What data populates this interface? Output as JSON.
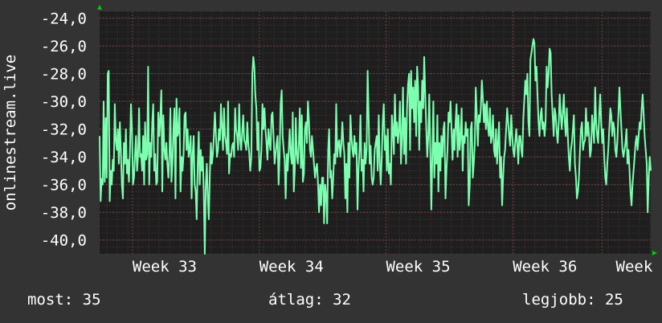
{
  "chart_data": {
    "type": "line",
    "ylabel": "onlinestream.live",
    "ylim": [
      -41,
      -23.5
    ],
    "yticks": [
      "-24,0",
      "-26,0",
      "-28,0",
      "-30,0",
      "-32,0",
      "-34,0",
      "-36,0",
      "-38,0",
      "-40,0"
    ],
    "ytick_values": [
      -24,
      -26,
      -28,
      -30,
      -32,
      -34,
      -36,
      -38,
      -40
    ],
    "xlim": [
      0,
      100
    ],
    "xticks": [
      "Week 33",
      "Week 34",
      "Week 35",
      "Week 36",
      "Week"
    ],
    "xtick_values": [
      11.8,
      34.8,
      57.8,
      80.8,
      97
    ],
    "grid": true,
    "line_color": "#7dffb0",
    "series": [
      {
        "values": [
          -32.5,
          -37.2,
          -35.6,
          -36.0,
          -30.0,
          -35.8,
          -31.2,
          -35.5,
          -28.0,
          -27.8,
          -37.2,
          -35.0,
          -36.0,
          -34.2,
          -35.0,
          -30.2,
          -32.8,
          -33.5,
          -32.0,
          -34.5,
          -31.5,
          -33.5,
          -36.0,
          -37.0,
          -33.0,
          -34.5,
          -32.0,
          -35.2,
          -34.2,
          -35.8,
          -33.5,
          -30.2,
          -32.0,
          -36.0,
          -35.5,
          -33.8,
          -32.5,
          -35.0,
          -34.0,
          -30.5,
          -34.0,
          -33.8,
          -35.0,
          -32.5,
          -36.0,
          -31.5,
          -34.2,
          -33.8,
          -27.5,
          -36.0,
          -33.0,
          -34.0,
          -31.5,
          -30.2,
          -35.0,
          -33.8,
          -36.0,
          -35.8,
          -30.8,
          -32.5,
          -31.2,
          -29.2,
          -36.5,
          -31.0,
          -33.5,
          -34.2,
          -33.0,
          -34.5,
          -35.5,
          -33.8,
          -30.5,
          -35.8,
          -34.5,
          -32.0,
          -30.5,
          -37.0,
          -29.8,
          -32.5,
          -32.2,
          -30.5,
          -36.5,
          -34.0,
          -35.0,
          -33.8,
          -31.0,
          -30.8,
          -33.5,
          -32.0,
          -34.0,
          -33.5,
          -32.5,
          -37.0,
          -33.8,
          -32.5,
          -36.0,
          -36.5,
          -38.5,
          -34.5,
          -32.2,
          -36.0,
          -33.5,
          -35.0,
          -34.0,
          -36.5,
          -41.0,
          -36.0,
          -34.5,
          -37.0,
          -38.5,
          -35.2,
          -33.0,
          -34.5,
          -33.8,
          -32.5,
          -30.8,
          -32.5,
          -34.0,
          -33.5,
          -32.0,
          -32.8,
          -30.2,
          -31.8,
          -33.5,
          -30.5,
          -32.5,
          -33.0,
          -33.8,
          -30.0,
          -35.2,
          -33.8,
          -34.0,
          -33.2,
          -33.0,
          -34.0,
          -30.5,
          -32.0,
          -32.5,
          -33.5,
          -30.2,
          -32.8,
          -33.5,
          -32.2,
          -31.0,
          -32.8,
          -33.0,
          -33.5,
          -31.5,
          -33.0,
          -33.8,
          -35.0,
          -34.0,
          -28.0,
          -26.8,
          -27.5,
          -29.5,
          -30.5,
          -33.5,
          -31.5,
          -35.0,
          -34.8,
          -33.5,
          -30.2,
          -32.0,
          -30.5,
          -32.0,
          -33.0,
          -34.2,
          -32.0,
          -33.0,
          -33.5,
          -31.0,
          -30.8,
          -32.5,
          -34.5,
          -33.8,
          -33.0,
          -32.5,
          -36.0,
          -33.8,
          -30.2,
          -29.2,
          -32.5,
          -33.5,
          -34.2,
          -37.0,
          -33.8,
          -35.0,
          -33.5,
          -32.0,
          -33.8,
          -34.5,
          -30.8,
          -36.5,
          -35.0,
          -31.2,
          -33.8,
          -34.5,
          -33.0,
          -30.5,
          -34.8,
          -31.0,
          -35.8,
          -35.2,
          -32.0,
          -31.5,
          -33.0,
          -30.0,
          -31.5,
          -33.5,
          -34.0,
          -32.5,
          -33.5,
          -34.5,
          -35.5,
          -34.8,
          -34.5,
          -36.0,
          -38.0,
          -36.0,
          -37.5,
          -35.5,
          -35.5,
          -38.8,
          -36.0,
          -36.8,
          -38.8,
          -33.5,
          -32.0,
          -35.5,
          -35.0,
          -37.0,
          -35.5,
          -33.8,
          -34.5,
          -30.2,
          -34.0,
          -33.0,
          -32.8,
          -34.0,
          -33.2,
          -31.5,
          -33.0,
          -33.8,
          -37.0,
          -34.5,
          -38.0,
          -33.0,
          -35.5,
          -31.0,
          -32.5,
          -33.5,
          -34.0,
          -32.5,
          -33.8,
          -33.0,
          -37.8,
          -35.0,
          -33.5,
          -31.0,
          -35.0,
          -34.2,
          -36.5,
          -33.0,
          -34.5,
          -33.5,
          -27.8,
          -31.0,
          -34.5,
          -33.2,
          -35.5,
          -36.0,
          -35.5,
          -33.5,
          -33.0,
          -32.5,
          -35.0,
          -31.0,
          -34.5,
          -36.0,
          -34.0,
          -31.5,
          -30.2,
          -33.5,
          -32.5,
          -35.0,
          -32.0,
          -35.2,
          -34.5,
          -36.0,
          -31.0,
          -32.0,
          -33.8,
          -29.5,
          -32.5,
          -31.5,
          -33.0,
          -32.0,
          -30.0,
          -34.5,
          -32.5,
          -29.0,
          -33.8,
          -31.2,
          -34.5,
          -30.5,
          -28.8,
          -28.0,
          -33.5,
          -27.8,
          -30.5,
          -29.0,
          -31.5,
          -28.5,
          -32.5,
          -27.5,
          -29.0,
          -33.5,
          -30.0,
          -31.5,
          -28.5,
          -30.5,
          -26.8,
          -29.5,
          -32.0,
          -34.0,
          -32.5,
          -29.5,
          -33.5,
          -37.8,
          -34.0,
          -30.0,
          -35.5,
          -33.0,
          -34.5,
          -31.0,
          -36.5,
          -33.0,
          -35.0,
          -32.5,
          -34.0,
          -32.0,
          -31.5,
          -37.0,
          -35.0,
          -33.5,
          -30.8,
          -31.5,
          -30.0,
          -32.0,
          -34.2,
          -32.0,
          -33.5,
          -31.5,
          -30.2,
          -34.0,
          -31.0,
          -33.5,
          -32.5,
          -30.5,
          -35.0,
          -32.5,
          -33.0,
          -31.5,
          -32.5,
          -32.0,
          -37.5,
          -36.0,
          -32.0,
          -31.5,
          -35.5,
          -34.5,
          -33.0,
          -29.0,
          -31.0,
          -33.2,
          -31.0,
          -31.5,
          -30.5,
          -28.5,
          -29.8,
          -31.5,
          -30.2,
          -32.0,
          -30.0,
          -31.8,
          -32.5,
          -30.5,
          -33.0,
          -32.5,
          -31.0,
          -33.5,
          -34.0,
          -32.0,
          -34.5,
          -33.0,
          -31.5,
          -35.5,
          -34.0,
          -37.5,
          -35.5,
          -34.0,
          -33.5,
          -32.0,
          -30.5,
          -31.5,
          -32.5,
          -33.2,
          -31.0,
          -32.5,
          -33.5,
          -34.0,
          -33.0,
          -32.0,
          -33.0,
          -34.5,
          -32.5,
          -32.5,
          -33.5,
          -34.0,
          -31.2,
          -29.8,
          -28.5,
          -29.5,
          -28.0,
          -31.5,
          -32.5,
          -27.0,
          -26.5,
          -26.0,
          -25.5,
          -25.8,
          -28.5,
          -27.5,
          -29.5,
          -31.5,
          -32.5,
          -31.0,
          -30.5,
          -32.0,
          -31.5,
          -32.5,
          -31.5,
          -27.5,
          -29.0,
          -28.0,
          -26.2,
          -26.5,
          -29.5,
          -31.0,
          -32.5,
          -30.5,
          -31.0,
          -32.2,
          -33.0,
          -31.5,
          -29.5,
          -31.0,
          -32.0,
          -30.8,
          -29.5,
          -31.5,
          -32.5,
          -30.5,
          -32.5,
          -34.0,
          -35.0,
          -33.5,
          -33.0,
          -32.0,
          -31.0,
          -34.5,
          -35.5,
          -37.0,
          -36.5,
          -35.5,
          -33.5,
          -32.0,
          -31.5,
          -33.5,
          -33.0,
          -32.8,
          -30.5,
          -32.5,
          -31.5,
          -32.5,
          -34.0,
          -33.5,
          -31.0,
          -32.0,
          -33.0,
          -29.0,
          -31.5,
          -32.5,
          -33.0,
          -31.0,
          -29.5,
          -31.5,
          -33.0,
          -32.0,
          -34.0,
          -35.5,
          -36.0,
          -34.5,
          -33.5,
          -32.0,
          -30.5,
          -31.0,
          -32.5,
          -31.5,
          -32.0,
          -33.5,
          -34.0,
          -32.8,
          -31.0,
          -29.0,
          -30.5,
          -32.0,
          -33.5,
          -34.0,
          -33.5,
          -33.0,
          -32.0,
          -34.5,
          -33.5,
          -35.0,
          -36.5,
          -37.5,
          -36.0,
          -35.0,
          -34.0,
          -33.0,
          -32.5,
          -33.5,
          -32.5,
          -31.5,
          -32.0,
          -30.5,
          -29.5,
          -31.0,
          -32.5,
          -33.5,
          -34.5,
          -38.0,
          -35.5,
          -34.0,
          -35.0
        ]
      }
    ],
    "stats": {
      "most_label": "most:",
      "most_value": "35",
      "atlag_label": "átlag:",
      "atlag_value": "32",
      "legjobb_label": "legjobb:",
      "legjobb_value": "25"
    }
  }
}
